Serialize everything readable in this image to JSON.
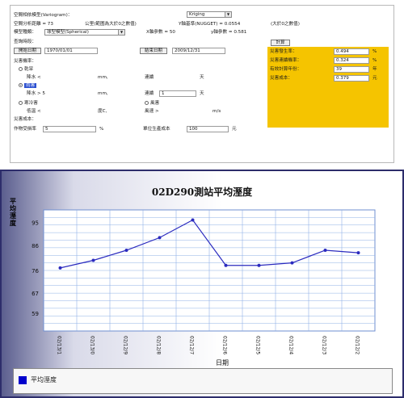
{
  "form": {
    "variogram_label": "空間相依模型(Variogram)：",
    "method_value": "Kriging",
    "range_label": "空間分析距離 = 73",
    "range_hint": "公里(範圍為大於0之數值)",
    "nugget_label": "Y軸基準(NUGGET) = 0.0554",
    "nugget_hint": "(大於0之數值)",
    "model_label": "模型種類：",
    "model_value": "球型模型(Spherical)",
    "x_param": "X軸參數 = 50",
    "y_param": "y軸參數 = 0.581",
    "query_label": "查詢時段：",
    "calc_button": "計算",
    "start_button": "開始日期",
    "start_date": "1970/01/01",
    "end_button": "結束日期",
    "end_date": "2009/12/31",
    "disaster_prob": "災害機率：",
    "drought": "乾旱",
    "rainfall_label": "降水 <",
    "rain_unit": "mm,",
    "duration_label": "連續",
    "day_unit": "天",
    "flood": "雨害",
    "rain2_label": "降水 > 5",
    "duration2_value": "1",
    "cold": "寒冷害",
    "temp_label": "低溫 <",
    "temp_unit": "度C,",
    "wind": "風害",
    "wind_label": "風速 >",
    "wind_unit": "m/s",
    "disaster_cost": "災害成本：",
    "crop_price_label": "作物受損率",
    "crop_price_value": "5",
    "percent": "%",
    "unit_cost_label": "單位生產成本",
    "unit_cost_value": "100",
    "yuan": "元",
    "results": [
      {
        "label": "災害發生率：",
        "value": "0.494",
        "unit": "%"
      },
      {
        "label": "災害連續機率：",
        "value": "0.324",
        "unit": "%"
      },
      {
        "label": "有效計算年份：",
        "value": "39",
        "unit": "年"
      },
      {
        "label": "災害成本：",
        "value": "0.379",
        "unit": "元"
      }
    ],
    "colors": {
      "highlight": "#f5c400",
      "selected": "#2a4fd0"
    }
  },
  "chart_data": {
    "type": "line",
    "title": "02D290測站平均溼度",
    "ylabel": "平均溼度",
    "xlabel": "日期",
    "categories": [
      "02/13/1",
      "02/13/0",
      "02/12/9",
      "02/12/8",
      "02/12/7",
      "02/12/6",
      "02/12/5",
      "02/12/4",
      "02/12/3",
      "02/12/2"
    ],
    "series": [
      {
        "name": "平均溼度",
        "values": [
          77,
          80,
          84,
          89,
          96,
          78,
          78,
          79,
          84,
          83
        ]
      }
    ],
    "yticks": [
      59,
      67,
      76,
      86,
      95
    ],
    "ylim": [
      52,
      100
    ],
    "grid": true,
    "legend_position": "bottom-left",
    "color": "#2b2bbf"
  }
}
